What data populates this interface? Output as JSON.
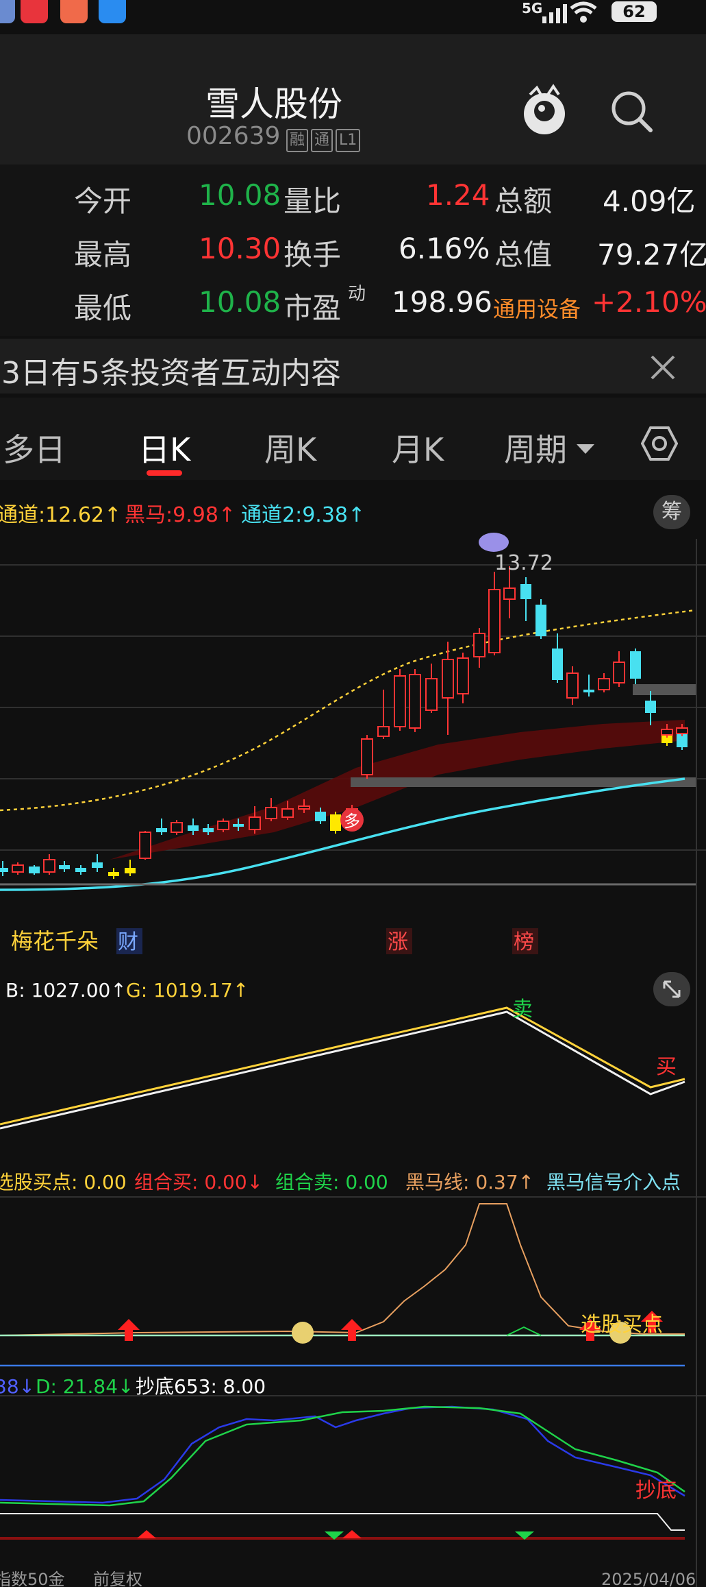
{
  "status_bar": {
    "network": "5G",
    "battery": "62"
  },
  "header": {
    "title": "雪人股份",
    "code": "002639",
    "tags": [
      "融",
      "通",
      "L1"
    ]
  },
  "quote": {
    "rows": [
      [
        {
          "label": "今开",
          "value": "10.08",
          "color": "green"
        },
        {
          "label": "量比",
          "value": "1.24",
          "color": "red"
        },
        {
          "label": "总额",
          "value": "4.09亿",
          "color": "white"
        }
      ],
      [
        {
          "label": "最高",
          "value": "10.30",
          "color": "red"
        },
        {
          "label": "换手",
          "value": "6.16%",
          "color": "white"
        },
        {
          "label": "总值",
          "value": "79.27亿",
          "color": "white"
        }
      ],
      [
        {
          "label": "最低",
          "value": "10.08",
          "color": "green"
        },
        {
          "label": "市盈",
          "value": "198.96",
          "color": "white"
        },
        {
          "label": "通用设备",
          "value": "+2.10%",
          "color": "red"
        }
      ]
    ],
    "pe_superscript": "动"
  },
  "notice": {
    "text": "3日有5条投资者互动内容"
  },
  "tabs": [
    {
      "label": "多日",
      "active": false
    },
    {
      "label": "日K",
      "active": true
    },
    {
      "label": "周K",
      "active": false
    },
    {
      "label": "月K",
      "active": false
    },
    {
      "label": "周期",
      "active": false,
      "dropdown": true
    }
  ],
  "main_indicator": {
    "items": [
      {
        "text": "通道:12.62↑",
        "color": "#ffd23a"
      },
      {
        "text": "黑马:9.98↑",
        "color": "#ff3434"
      },
      {
        "text": "通道2:9.38↑",
        "color": "#48e0f0"
      }
    ],
    "chip_label": "筹",
    "max_price_label": "13.72",
    "marker_duo": "多",
    "bottom_labels": {
      "left": "梅花千朵",
      "fin": "财",
      "zhang": "涨",
      "bang": "榜"
    }
  },
  "sub1": {
    "items": [
      {
        "text": "B: 1027.00↑",
        "color": "#ffffff"
      },
      {
        "text": "G: 1019.17↑",
        "color": "#ffd23a"
      }
    ],
    "sell_label": "卖",
    "buy_label": "买"
  },
  "sub2": {
    "items": [
      {
        "text": "选股买点: 0.00",
        "color": "#ffd23a"
      },
      {
        "text": "组合买: 0.00↓",
        "color": "#ff3434"
      },
      {
        "text": "组合卖: 0.00",
        "color": "#1fd34a"
      },
      {
        "text": "黑马线: 0.37↑",
        "color": "#e8a060"
      },
      {
        "text": "黑马信号介入点",
        "color": "#7ee0f0"
      }
    ],
    "select_label": "选股买点"
  },
  "sub3": {
    "items": [
      {
        "text": "38↓",
        "color": "#5060ff"
      },
      {
        "text": "D: 21.84↓",
        "color": "#1fd34a"
      },
      {
        "text": "抄底653: 8.00",
        "color": "#ffffff"
      }
    ],
    "bottom_label": "抄底"
  },
  "footer": {
    "left": "指数50金",
    "mid": "前复权",
    "date": "2025/04/06"
  }
}
